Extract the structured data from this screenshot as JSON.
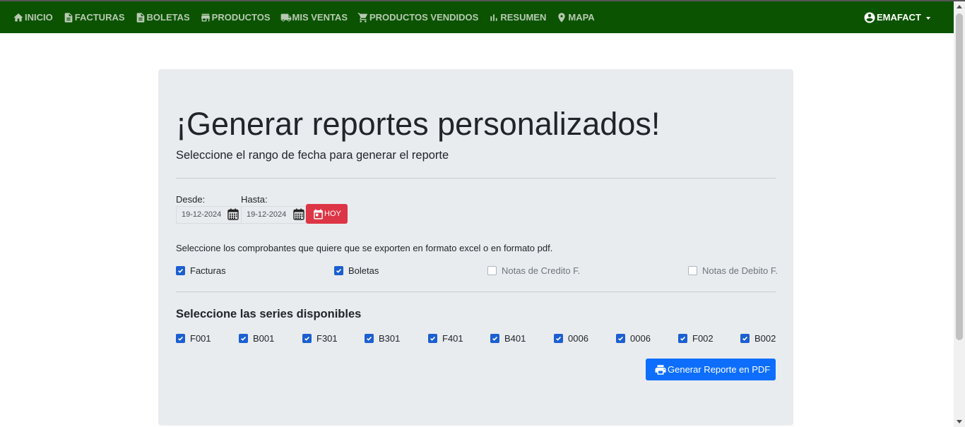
{
  "nav": {
    "items": [
      {
        "label": "INICIO",
        "icon": "home-icon"
      },
      {
        "label": "FACTURAS",
        "icon": "document-icon"
      },
      {
        "label": "BOLETAS",
        "icon": "document-icon"
      },
      {
        "label": "PRODUCTOS",
        "icon": "store-icon"
      },
      {
        "label": "MIS VENTAS",
        "icon": "truck-icon"
      },
      {
        "label": "PRODUCTOS VENDIDOS",
        "icon": "cart-icon"
      },
      {
        "label": "RESUMEN",
        "icon": "bar-chart-icon"
      },
      {
        "label": "MAPA",
        "icon": "map-pin-icon"
      }
    ],
    "user": "EMAFACT",
    "bg_color": "#0b5300"
  },
  "main": {
    "title": "¡Generar reportes personalizados!",
    "subtitle": "Seleccione el rango de fecha para generar el reporte",
    "from_label": "Desde:",
    "to_label": "Hasta:",
    "from_value": "19-12-2024",
    "to_value": "19-12-2024",
    "today_button": "HOY",
    "types_prompt": "Seleccione los comprobantes que quiere que se exporten en formato excel o en formato pdf.",
    "types": [
      {
        "label": "Facturas",
        "checked": true
      },
      {
        "label": "Boletas",
        "checked": true
      },
      {
        "label": "Notas de Credito F.",
        "checked": false
      },
      {
        "label": "Notas de Debito F.",
        "checked": false
      }
    ],
    "series_title": "Seleccione las series disponibles",
    "series": [
      {
        "label": "F001",
        "checked": true
      },
      {
        "label": "B001",
        "checked": true
      },
      {
        "label": "F301",
        "checked": true
      },
      {
        "label": "B301",
        "checked": true
      },
      {
        "label": "F401",
        "checked": true
      },
      {
        "label": "B401",
        "checked": true
      },
      {
        "label": "0006",
        "checked": true
      },
      {
        "label": "0006",
        "checked": true
      },
      {
        "label": "F002",
        "checked": true
      },
      {
        "label": "B002",
        "checked": true
      }
    ],
    "pdf_button": "Generar Reporte en PDF"
  },
  "colors": {
    "danger": "#dc3545",
    "primary": "#0d6efd",
    "panel": "#e9ecef"
  }
}
